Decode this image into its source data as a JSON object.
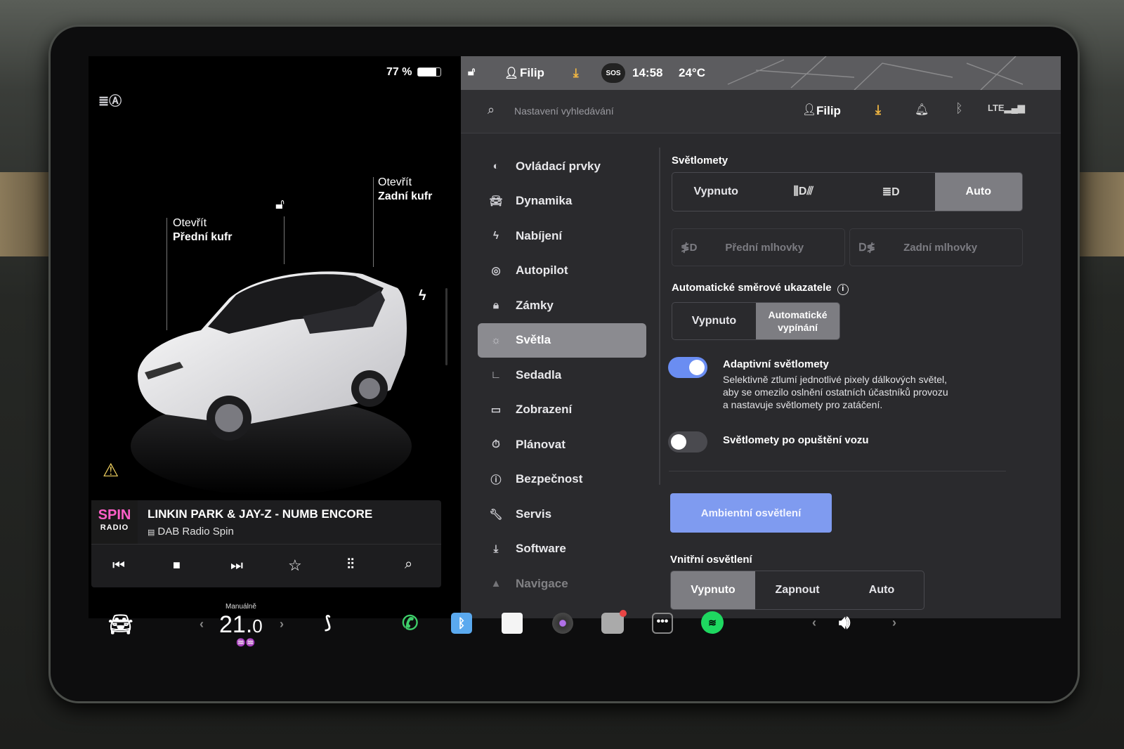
{
  "status": {
    "battery": "77 %",
    "user": "Filip",
    "time": "14:58",
    "temp": "24°C",
    "sos": "SOS"
  },
  "search": {
    "placeholder": "Nastavení vyhledávání",
    "user": "Filip"
  },
  "left": {
    "front_trunk_l1": "Otevřít",
    "front_trunk_l2": "Přední kufr",
    "rear_trunk_l1": "Otevřít",
    "rear_trunk_l2": "Zadní kufr"
  },
  "media": {
    "title": "LINKIN PARK & JAY-Z - NUMB ENCORE",
    "source": "DAB Radio Spin",
    "logo_top": "SPIN",
    "logo_bottom": "RADIO"
  },
  "menu": [
    "Ovládací prvky",
    "Dynamika",
    "Nabíjení",
    "Autopilot",
    "Zámky",
    "Světla",
    "Sedadla",
    "Zobrazení",
    "Plánovat",
    "Bezpečnost",
    "Servis",
    "Software",
    "Navigace"
  ],
  "menu_icons": [
    "toggle-icon",
    "car-icon",
    "bolt-icon",
    "steering-wheel-icon",
    "lock-icon",
    "sun-icon",
    "seat-icon",
    "display-icon",
    "clock-icon",
    "info-icon",
    "wrench-icon",
    "download-icon",
    "navigation-icon"
  ],
  "lights": {
    "heading": "Světlomety",
    "options": [
      "Vypnuto",
      "",
      "",
      "Auto"
    ],
    "selected": "Auto",
    "front_fog": "Přední mlhovky",
    "rear_fog": "Zadní mlhovky",
    "auto_signal_heading": "Automatické směrové ukazatele",
    "signal_off": "Vypnuto",
    "signal_auto_l1": "Automatické",
    "signal_auto_l2": "vypínání",
    "adaptive_title": "Adaptivní světlomety",
    "adaptive_desc_1": "Selektivně ztlumí jednotlivé pixely dálkových světel,",
    "adaptive_desc_2": "aby se omezilo oslnění ostatních účastníků provozu",
    "adaptive_desc_3": "a nastavuje světlomety pro zatáčení.",
    "adaptive_on": true,
    "exit_title": "Světlomety po opuštění vozu",
    "exit_on": false,
    "ambient_button": "Ambientní osvětlení",
    "interior_heading": "Vnitřní osvětlení",
    "interior_options": [
      "Vypnuto",
      "Zapnout",
      "Auto"
    ],
    "interior_selected": "Vypnuto"
  },
  "dock": {
    "temp_mode": "Manuálně",
    "temp_int": "21.",
    "temp_dec": "0"
  },
  "colors": {
    "accent": "#6f8ff0",
    "toggle_on": "#6a8df2",
    "ambient_btn": "#7f9bf0"
  }
}
